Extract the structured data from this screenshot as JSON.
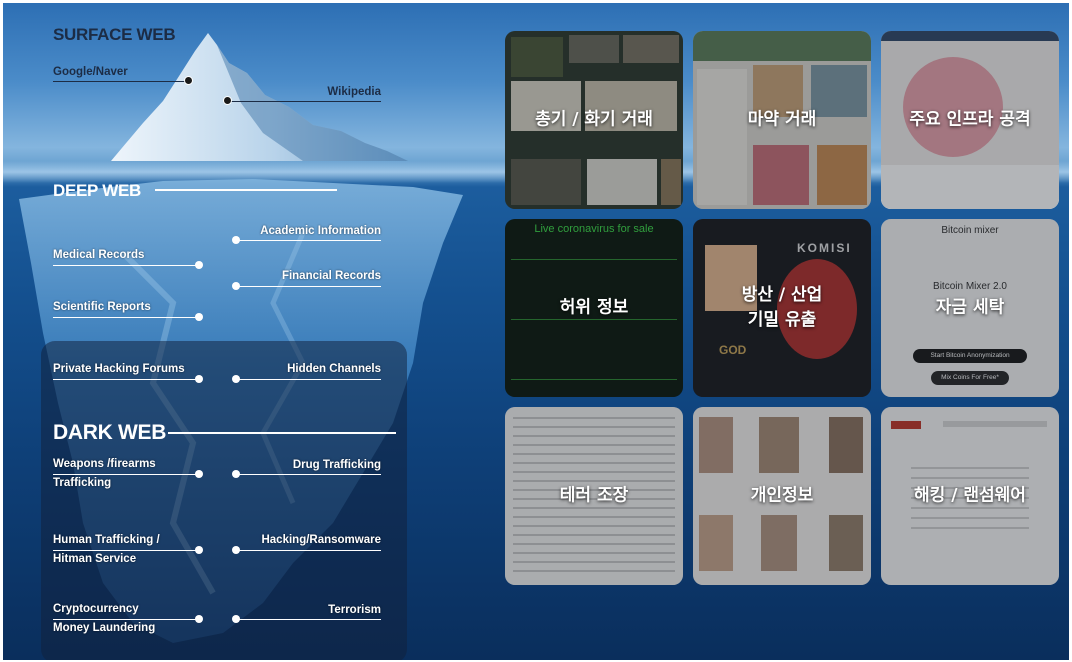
{
  "layers": {
    "surface": "SURFACE WEB",
    "deep": "DEEP WEB",
    "dark": "DARK WEB"
  },
  "labels": {
    "google_naver": "Google/Naver",
    "wikipedia": "Wikipedia",
    "academic": "Academic Information",
    "medical": "Medical Records",
    "financial": "Financial Records",
    "scientific": "Scientific Reports",
    "private_hacking": "Private Hacking Forums",
    "hidden_channels": "Hidden Channels",
    "weapons": "Weapons /firearms\nTrafficking",
    "drug": "Drug Trafficking",
    "human": "Human Trafficking /\nHitman Service",
    "hacking": "Hacking/Ransomware",
    "crypto": "Cryptocurrency\nMoney Laundering",
    "terrorism": "Terrorism"
  },
  "tiles": [
    {
      "caption": "총기 / 화기 거래",
      "theme": "guns"
    },
    {
      "caption": "마약 거래",
      "theme": "drugs"
    },
    {
      "caption": "주요 인프라 공격",
      "theme": "infra"
    },
    {
      "caption": "허위 정보",
      "theme": "disinfo"
    },
    {
      "caption": "방산 / 산업\n기밀 유출",
      "theme": "leak"
    },
    {
      "caption": "자금 세탁",
      "theme": "mixer"
    },
    {
      "caption": "테러 조장",
      "theme": "terror"
    },
    {
      "caption": "개인정보",
      "theme": "pii"
    },
    {
      "caption": "해킹 / 랜섬웨어",
      "theme": "ransom"
    }
  ],
  "tile_text": {
    "corona": "Live coronavirus for sale",
    "mixer_title": "Bitcoin mixer",
    "mixer_sub": "Bitcoin Mixer 2.0",
    "mixer_btn1": "Start Bitcoin Anonymization",
    "mixer_btn2": "Mix Coins For Free*",
    "komisi": "KOMISI",
    "god": "GOD"
  },
  "colors": {
    "deep_water": "#0e3f77",
    "sky": "#4b8cc9",
    "label_line": "#ffffff"
  }
}
